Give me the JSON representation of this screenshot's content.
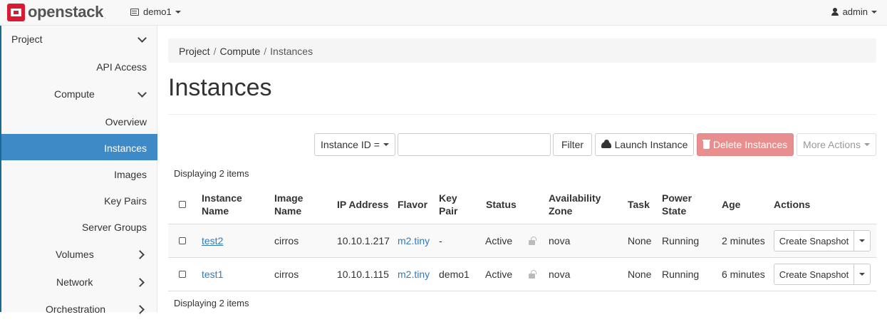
{
  "navbar": {
    "brand": "openstack",
    "brand_tm": ".",
    "project": "demo1",
    "user": "admin"
  },
  "sidebar": {
    "project": "Project",
    "api_access": "API Access",
    "compute": "Compute",
    "overview": "Overview",
    "instances": "Instances",
    "images": "Images",
    "key_pairs": "Key Pairs",
    "server_groups": "Server Groups",
    "volumes": "Volumes",
    "network": "Network",
    "orchestration": "Orchestration"
  },
  "breadcrumb": {
    "project": "Project",
    "compute": "Compute",
    "current": "Instances",
    "sep": "/"
  },
  "page_title": "Instances",
  "toolbar": {
    "filter_field": "Instance ID =",
    "filter_value": "",
    "filter_button": "Filter",
    "launch_button": "Launch Instance",
    "delete_button": "Delete Instances",
    "more_actions": "More Actions"
  },
  "table": {
    "count_top": "Displaying 2 items",
    "count_bottom": "Displaying 2 items",
    "headers": {
      "instance_name": [
        "Instance",
        "Name"
      ],
      "image_name": [
        "Image",
        "Name"
      ],
      "ip": "IP Address",
      "flavor": "Flavor",
      "key_pair": [
        "Key",
        "Pair"
      ],
      "status": "Status",
      "az": [
        "Availability",
        "Zone"
      ],
      "task": "Task",
      "power": [
        "Power",
        "State"
      ],
      "age": "Age",
      "actions": "Actions"
    },
    "rows": [
      {
        "name": "test2",
        "image": "cirros",
        "ip": "10.10.1.217",
        "flavor": "m2.tiny",
        "key_pair": "-",
        "status": "Active",
        "az": "nova",
        "task": "None",
        "power": "Running",
        "age": "2 minutes",
        "action": "Create Snapshot"
      },
      {
        "name": "test1",
        "image": "cirros",
        "ip": "10.10.1.115",
        "flavor": "m2.tiny",
        "key_pair": "demo1",
        "status": "Active",
        "az": "nova",
        "task": "None",
        "power": "Running",
        "age": "6 minutes",
        "action": "Create Snapshot"
      }
    ]
  },
  "colors": {
    "brand_red": "#da1a32",
    "active_nav": "#3e8ac6",
    "link": "#337ab7",
    "danger": "#e98e8e"
  }
}
